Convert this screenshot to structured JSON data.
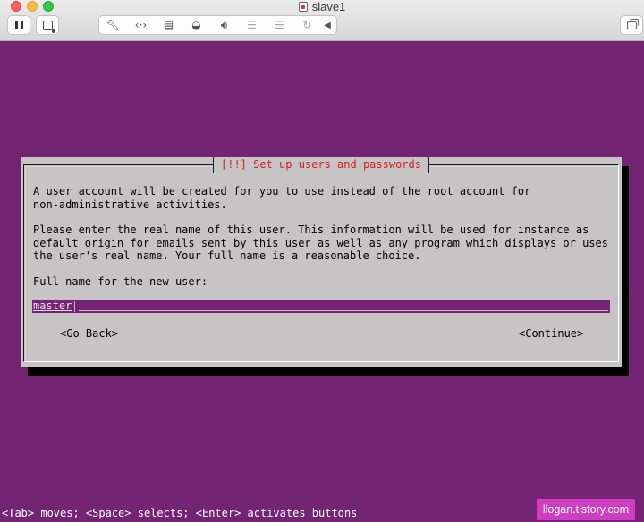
{
  "window": {
    "title": "slave1",
    "toolbar_icons": [
      "pause-icon",
      "snapshot-icon",
      "wrench-icon",
      "network-icon",
      "disk-icon",
      "camera-icon",
      "speaker-icon",
      "usb-icon",
      "usb-icon",
      "refresh-icon",
      "chevron-left-icon",
      "fullscreen-icon"
    ]
  },
  "dialog": {
    "title": "[!!] Set up users and passwords",
    "paragraph1": "A user account will be created for you to use instead of the root account for\nnon-administrative activities.",
    "paragraph2": "Please enter the real name of this user. This information will be used for instance as\ndefault origin for emails sent by this user as well as any program which displays or uses\nthe user's real name. Your full name is a reasonable choice.",
    "field_label": "Full name for the new user:",
    "field_value": "master",
    "back_button": "<Go Back>",
    "continue_button": "<Continue>"
  },
  "footer": {
    "hint": "<Tab> moves; <Space> selects; <Enter> activates buttons",
    "watermark": "llogan.tistory.com"
  },
  "colors": {
    "background": "#732472",
    "dialog": "#c7c4c5",
    "title_text": "#d22020",
    "watermark": "#cf3ec1"
  }
}
